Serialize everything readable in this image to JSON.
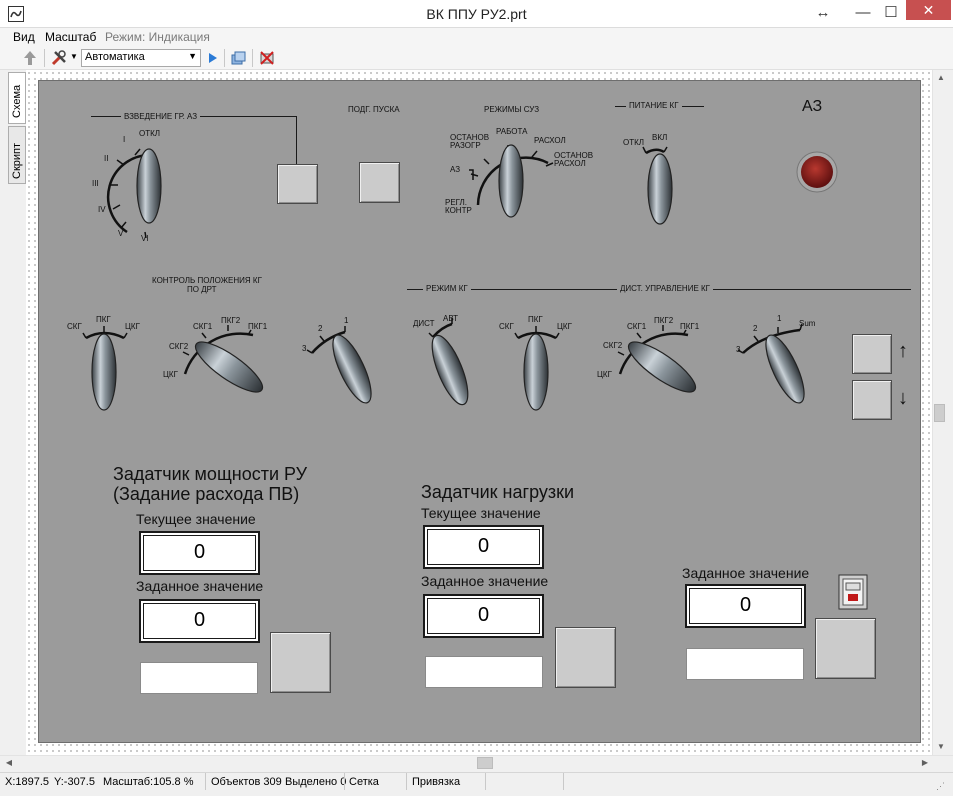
{
  "window": {
    "title": "ВК ППУ РУ2.prt"
  },
  "menu": {
    "view": "Вид",
    "scale": "Масштаб",
    "mode": "Режим: Индикация"
  },
  "toolbar": {
    "mode_value": "Автоматика"
  },
  "tabs": {
    "schema": "Схема",
    "script": "Скрипт"
  },
  "panel": {
    "az_arm": {
      "title": "ВЗВЕДЕНИЕ ГР. АЗ",
      "positions": {
        "off": "ОТКЛ",
        "p1": "I",
        "p2": "II",
        "p3": "III",
        "p4": "IV",
        "p5": "V",
        "p6": "VI"
      }
    },
    "start_prep": {
      "title": "ПОДГ. ПУСКА"
    },
    "suz_modes": {
      "title": "РЕЖИМЫ СУЗ",
      "positions": {
        "work": "РАБОТА",
        "stop_heat_1": "ОСТАНОВ",
        "stop_heat_2": "РАЗОГР",
        "cool": "РАСХОЛ",
        "stop_cool_1": "ОСТАНОВ",
        "stop_cool_2": "РАСХОЛ",
        "az": "АЗ",
        "reg_1": "РЕГЛ.",
        "reg_2": "КОНТР"
      }
    },
    "kg_power": {
      "title": "ПИТАНИЕ КГ",
      "off": "ОТКЛ",
      "on": "ВКЛ"
    },
    "az_title": "АЗ",
    "kg_control": {
      "title_1": "КОНТРОЛЬ ПОЛОЖЕНИЯ КГ",
      "title_2": "ПО ДРТ"
    },
    "kg_mode": {
      "title": "РЕЖИМ КГ",
      "dist": "ДИСТ",
      "auto": "АВТ"
    },
    "kg_remote": {
      "title": "ДИСТ. УПРАВЛЕНИЕ КГ"
    },
    "sw_labels": {
      "skg": "СКГ",
      "pkg": "ПКГ",
      "ckg": "ЦКГ",
      "skg1": "СКГ1",
      "skg2": "СКГ2",
      "pkg1": "ПКГ1",
      "pkg2": "ПКГ2",
      "n1": "1",
      "n2": "2",
      "n3": "3",
      "sum": "Sum"
    },
    "arrows": {
      "up": "↑",
      "down": "↓"
    },
    "ru_power": {
      "title_1": "Задатчик мощности РУ",
      "title_2": "(Задание расхода ПВ)",
      "current_label": "Текущее значение",
      "current_value": "0",
      "set_label": "Заданное значение",
      "set_value": "0"
    },
    "load": {
      "title": "Задатчик нагрузки",
      "current_label": "Текущее значение",
      "current_value": "0",
      "set_label": "Заданное значение",
      "set_value": "0"
    },
    "setpoint3": {
      "set_label": "Заданное значение",
      "set_value": "0"
    }
  },
  "status": {
    "x": "X:1897.5",
    "y": "Y:-307.5",
    "scale": "Масштаб:105.8 %",
    "objects": "Объектов 309",
    "selected": "Выделено 0",
    "grid": "Сетка",
    "snap": "Привязка"
  },
  "colors": {
    "panel": "#9b9b9b",
    "lamp": "#8b1a1a",
    "close": "#c75050"
  }
}
